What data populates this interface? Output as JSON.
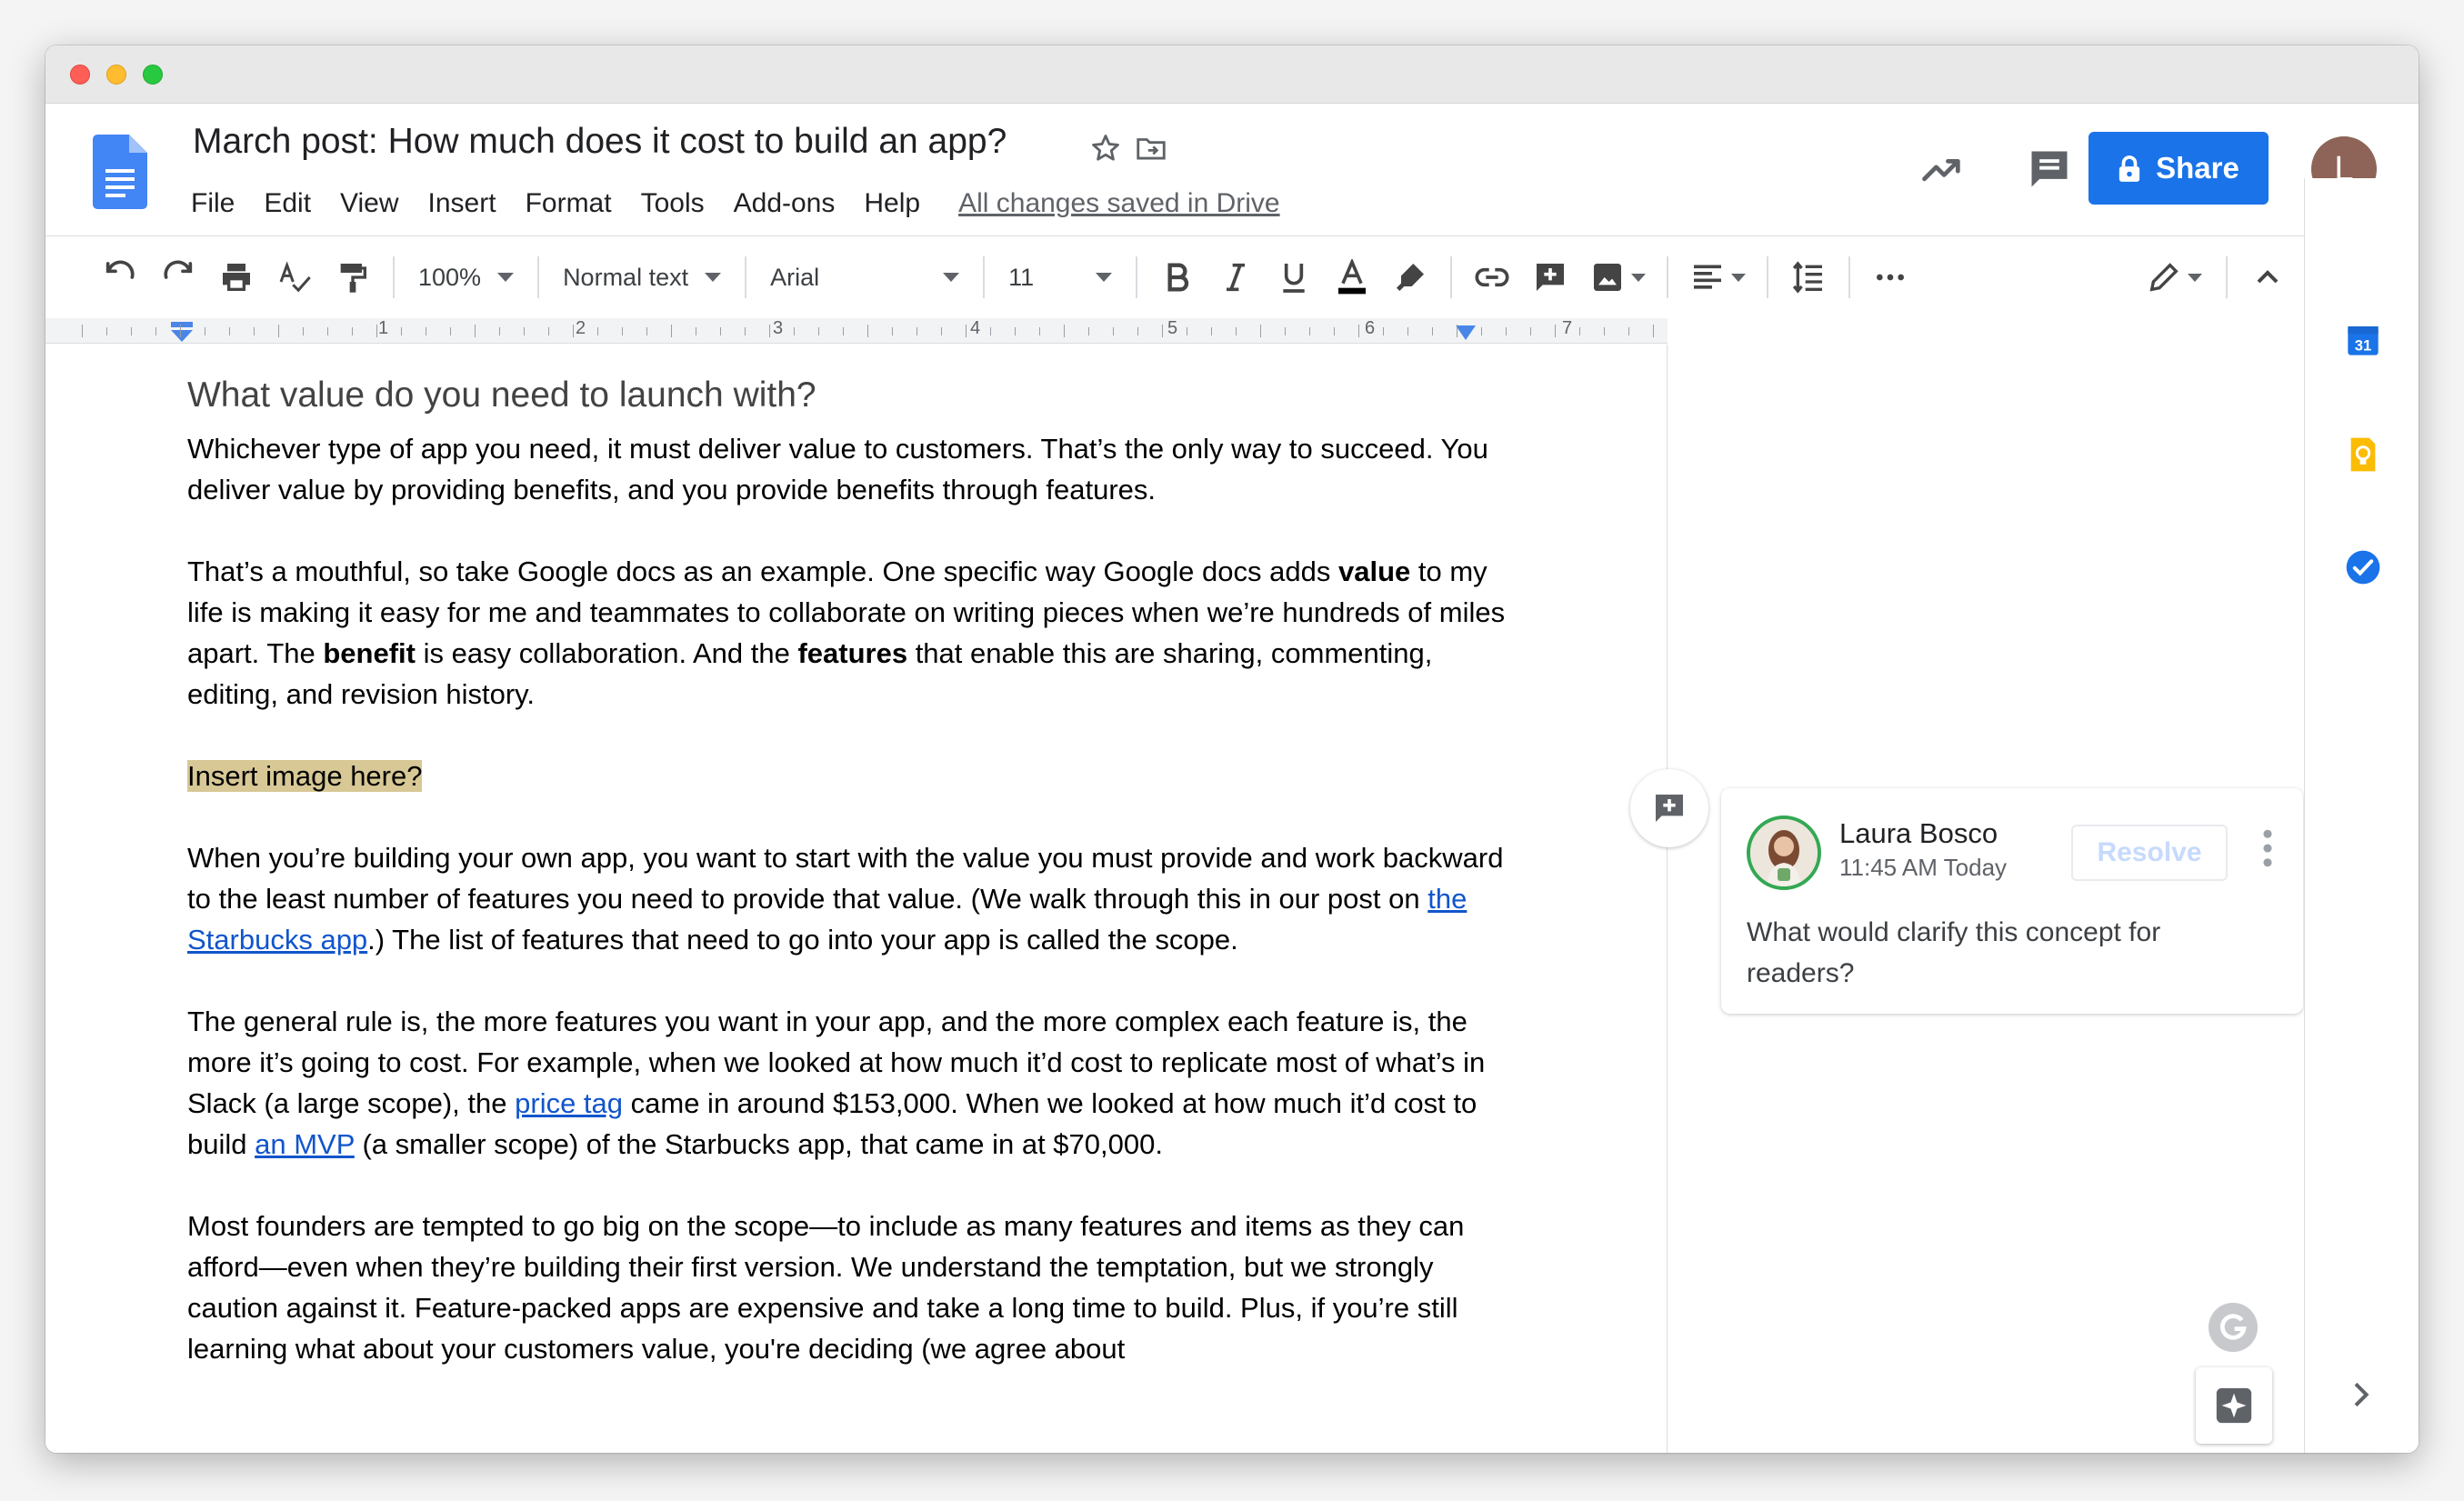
{
  "window": {
    "controls": [
      "close",
      "minimize",
      "maximize"
    ]
  },
  "header": {
    "title": "March post: How much does it cost to build an app?",
    "menu": [
      "File",
      "Edit",
      "View",
      "Insert",
      "Format",
      "Tools",
      "Add-ons",
      "Help"
    ],
    "save_status": "All changes saved in Drive",
    "share_label": "Share",
    "avatar_initial": "L",
    "brand_color": "#1a73e8"
  },
  "toolbar": {
    "zoom": "100%",
    "style": "Normal text",
    "font": "Arial",
    "size": "11"
  },
  "ruler": {
    "numbers": [
      "1",
      "2",
      "3",
      "4",
      "5",
      "6",
      "7"
    ]
  },
  "document": {
    "heading": "What value do you need to launch with?",
    "p1": "Whichever type of app you need, it must deliver value to customers. That’s the only way to succeed. You deliver value by providing benefits, and you provide benefits through features.",
    "p2": {
      "a": "That’s a mouthful, so take Google docs as an example. One specific way Google docs adds ",
      "b": "value",
      "c": " to my life is making it easy for me and teammates to collaborate on writing pieces when we’re hundreds of miles apart. The ",
      "d": "benefit",
      "e": " is easy collaboration. And the ",
      "f": "features",
      "g": " that enable this are sharing, commenting, editing, and revision history."
    },
    "highlight": "Insert image here?",
    "p3": {
      "a": "When you’re building your own app, you want to start with the value you must provide and work backward to the least number of features you need to provide that value. (We walk through this in our post on ",
      "link": "the Starbucks app",
      "b": ".) The list of features that need to go into your app is called the scope."
    },
    "p4": {
      "a": "The general rule is, the more features you want in your app, and the more complex each feature is, the more it’s going to cost. For example, when we looked at how much it’d cost to replicate most of what’s in Slack (a large scope), the ",
      "link1": "price tag",
      "b": " came in around $153,000. When we looked at how much it’d cost to build ",
      "link2": "an MVP",
      "c": " (a smaller scope) of the Starbucks app, that came in at $70,000."
    },
    "p5": "Most founders are tempted to go big on the scope—to include as many features and items as they can afford—even when they’re building their first version. We understand the temptation, but we strongly caution against it. Feature-packed apps are expensive and take a long time to build. Plus, if you’re still learning what about your customers value, you're deciding (we agree about"
  },
  "comment": {
    "author": "Laura Bosco",
    "time": "11:45 AM Today",
    "resolve_label": "Resolve",
    "text": "What would clarify this concept for readers?"
  },
  "side_panel": {
    "calendar_day": "31",
    "icons": [
      "calendar-icon",
      "keep-icon",
      "tasks-icon"
    ]
  }
}
